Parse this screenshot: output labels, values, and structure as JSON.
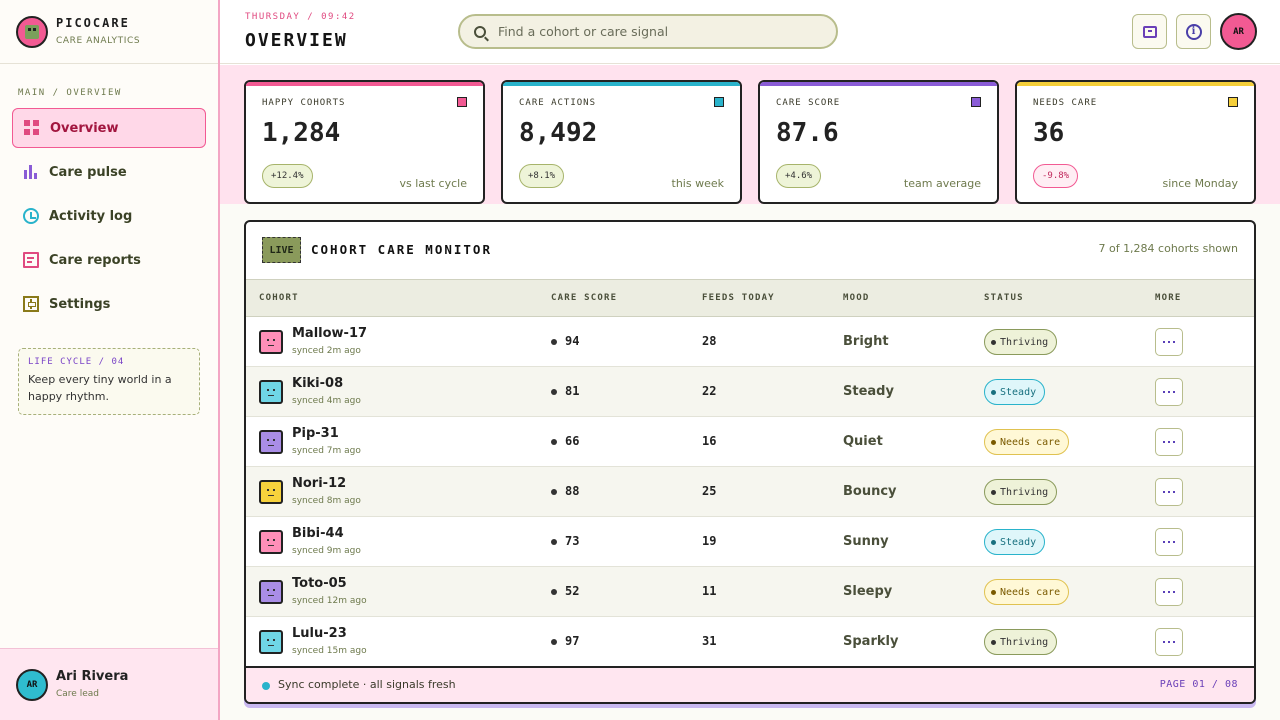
{
  "brand": {
    "name": "PICOCARE",
    "subtitle": "CARE ANALYTICS"
  },
  "sidebar": {
    "section_label": "MAIN / OVERVIEW",
    "items": [
      {
        "label": "Overview",
        "icon": "grid-icon",
        "active": true
      },
      {
        "label": "Care pulse",
        "icon": "bar-chart-icon"
      },
      {
        "label": "Activity log",
        "icon": "clock-icon"
      },
      {
        "label": "Care reports",
        "icon": "report-icon"
      },
      {
        "label": "Settings",
        "icon": "settings-icon"
      }
    ],
    "life_card": {
      "title": "LIFE CYCLE / 04",
      "text": "Keep every tiny world in a happy rhythm."
    },
    "user": {
      "initials": "AR",
      "name": "Ari Rivera",
      "role": "Care lead"
    }
  },
  "header": {
    "kicker": "THURSDAY / 09:42",
    "title": "OVERVIEW",
    "search_placeholder": "Find a cohort or care signal",
    "avatar_initials": "AR",
    "icons": [
      "chat-icon",
      "info-icon"
    ]
  },
  "stats": [
    {
      "label": "HAPPY COHORTS",
      "value": "1,284",
      "delta": "+12.4%",
      "delta_type": "pos",
      "note": "vs last cycle",
      "color": "#f25a93"
    },
    {
      "label": "CARE ACTIONS",
      "value": "8,492",
      "delta": "+8.1%",
      "delta_type": "pos",
      "note": "this week",
      "color": "#29b3cb"
    },
    {
      "label": "CARE SCORE",
      "value": "87.6",
      "delta": "+4.6%",
      "delta_type": "pos",
      "note": "team average",
      "color": "#8a5cd6"
    },
    {
      "label": "NEEDS CARE",
      "value": "36",
      "delta": "-9.8%",
      "delta_type": "neg",
      "note": "since Monday",
      "color": "#f5cf3a"
    }
  ],
  "monitor": {
    "badge": "LIVE",
    "title": "COHORT CARE MONITOR",
    "count": "7 of 1,284 cohorts shown",
    "columns": [
      "COHORT",
      "CARE SCORE",
      "FEEDS TODAY",
      "MOOD",
      "STATUS",
      "MORE"
    ],
    "rows": [
      {
        "name": "Mallow-17",
        "synced": "synced 2m ago",
        "score": "94",
        "feeds": "28",
        "mood": "Bright",
        "status": "Thriving",
        "status_type": "thriving",
        "avatar_color": "#ff8fb8"
      },
      {
        "name": "Kiki-08",
        "synced": "synced 4m ago",
        "score": "81",
        "feeds": "22",
        "mood": "Steady",
        "status": "Steady",
        "status_type": "steady",
        "avatar_color": "#6fd6e6"
      },
      {
        "name": "Pip-31",
        "synced": "synced 7m ago",
        "score": "66",
        "feeds": "16",
        "mood": "Quiet",
        "status": "Needs care",
        "status_type": "needs",
        "avatar_color": "#a98de6"
      },
      {
        "name": "Nori-12",
        "synced": "synced 8m ago",
        "score": "88",
        "feeds": "25",
        "mood": "Bouncy",
        "status": "Thriving",
        "status_type": "thriving",
        "avatar_color": "#f7d23c"
      },
      {
        "name": "Bibi-44",
        "synced": "synced 9m ago",
        "score": "73",
        "feeds": "19",
        "mood": "Sunny",
        "status": "Steady",
        "status_type": "steady",
        "avatar_color": "#ff8fb8"
      },
      {
        "name": "Toto-05",
        "synced": "synced 12m ago",
        "score": "52",
        "feeds": "11",
        "mood": "Sleepy",
        "status": "Needs care",
        "status_type": "needs",
        "avatar_color": "#a98de6"
      },
      {
        "name": "Lulu-23",
        "synced": "synced 15m ago",
        "score": "97",
        "feeds": "31",
        "mood": "Sparkly",
        "status": "Thriving",
        "status_type": "thriving",
        "avatar_color": "#6fd6e6"
      }
    ],
    "footer_status": "Sync complete · all signals fresh",
    "footer_page": "PAGE 01 / 08"
  }
}
